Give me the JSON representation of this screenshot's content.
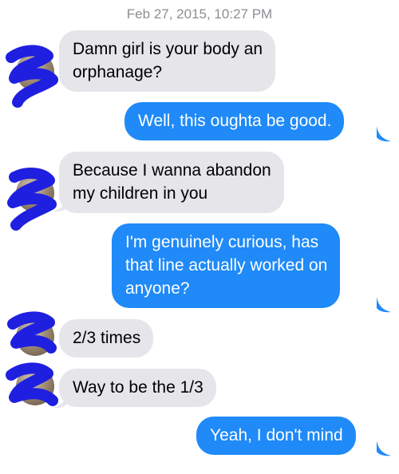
{
  "header": {
    "timestamp": "Feb 27, 2015, 10:27 PM"
  },
  "colors": {
    "incoming_bubble": "#e5e5ea",
    "outgoing_bubble": "#1f8af8",
    "redaction": "#1f1fe0"
  },
  "messages": [
    {
      "direction": "incoming",
      "lines": [
        "Damn girl is your body an",
        "orphanage?"
      ]
    },
    {
      "direction": "outgoing",
      "lines": [
        "Well, this oughta be good."
      ]
    },
    {
      "direction": "incoming",
      "lines": [
        "Because I wanna abandon",
        "my children in you"
      ]
    },
    {
      "direction": "outgoing",
      "lines": [
        "I'm genuinely curious, has",
        "that line actually worked on",
        "anyone?"
      ]
    },
    {
      "direction": "incoming",
      "lines": [
        "2/3 times"
      ]
    },
    {
      "direction": "incoming",
      "lines": [
        "Way to be the 1/3"
      ]
    },
    {
      "direction": "outgoing",
      "lines": [
        "Yeah, I don't mind"
      ]
    }
  ]
}
